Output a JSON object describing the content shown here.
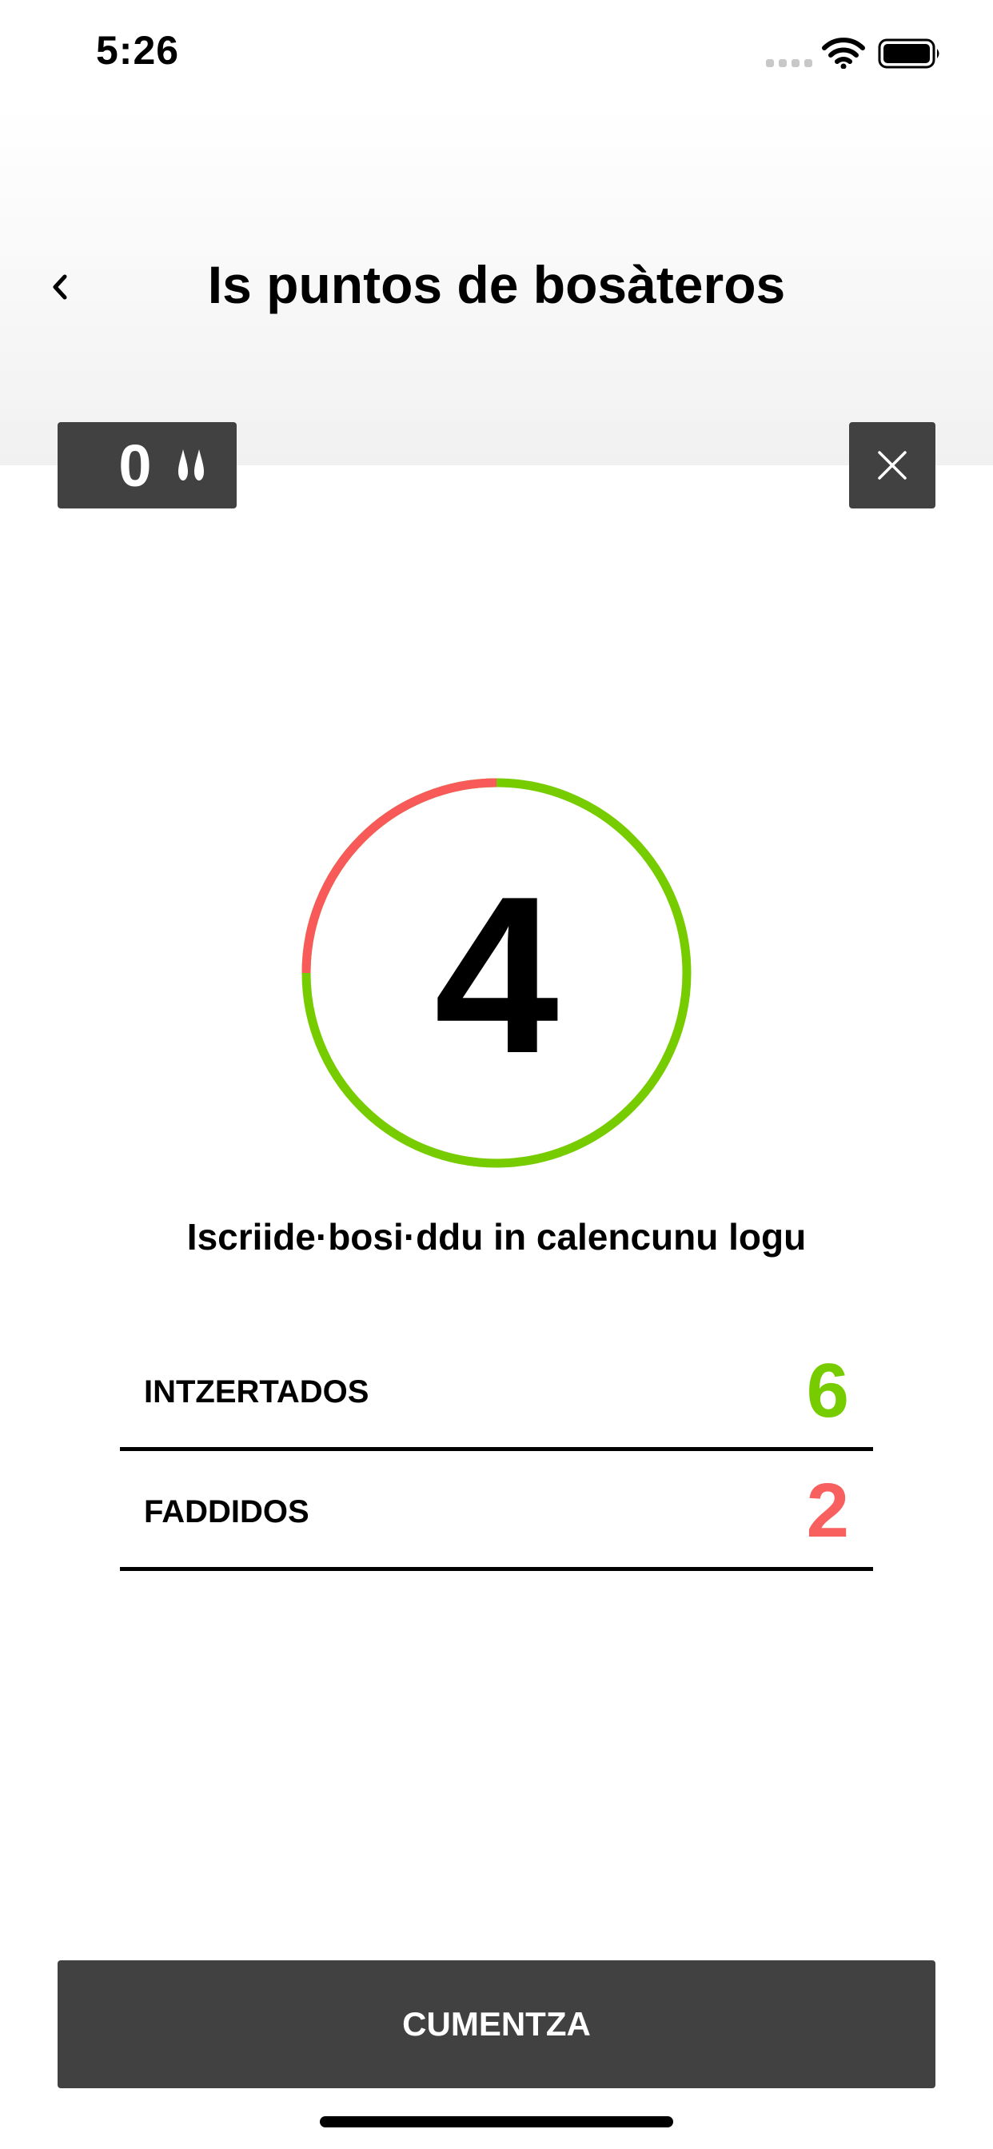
{
  "status_bar": {
    "time": "5:26"
  },
  "header": {
    "title": "Is puntos de bosàteros"
  },
  "score": {
    "value": "0"
  },
  "countdown": {
    "value": "4",
    "elapsed_fraction": 0.25,
    "elapsed_color": "#f85a5a",
    "remaining_color": "#77cc00"
  },
  "instruction": "Iscriide·bosi·ddu in calencunu logu",
  "stats": [
    {
      "label": "INTZERTADOS",
      "value": "6",
      "color": "#77cc00"
    },
    {
      "label": "FADDIDOS",
      "value": "2",
      "color": "#f86060"
    }
  ],
  "start_button": {
    "label": "CUMENTZA"
  },
  "icons": {
    "back": "chevron-left-icon",
    "score": "drops-icon",
    "close": "close-icon",
    "signal": "signal-icon",
    "wifi": "wifi-icon",
    "battery": "battery-icon"
  }
}
